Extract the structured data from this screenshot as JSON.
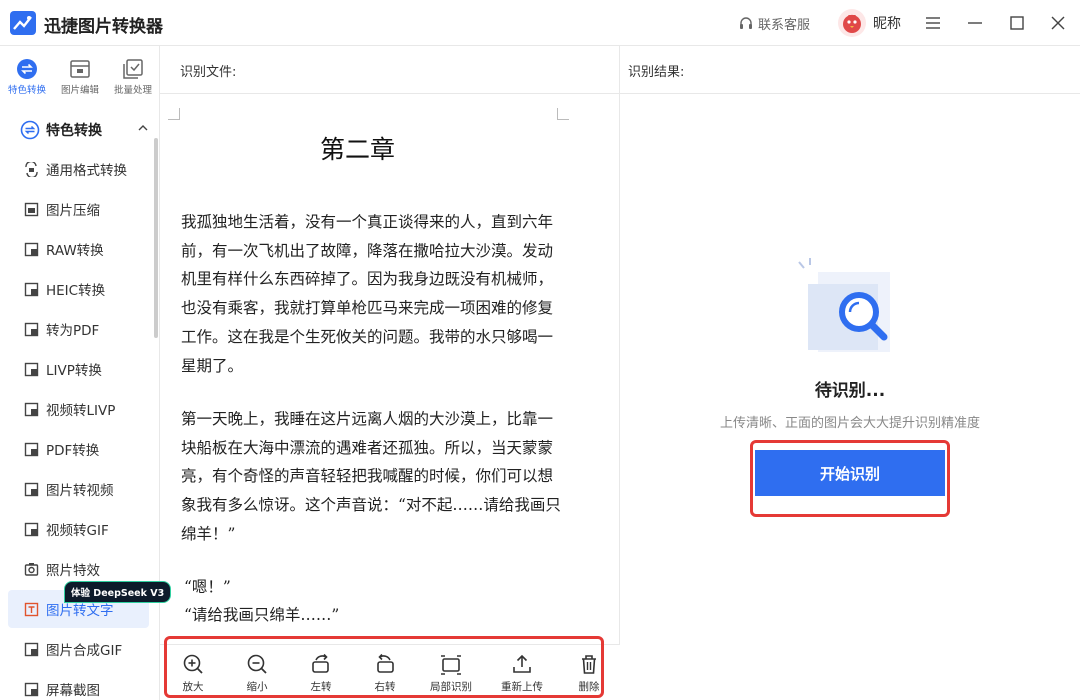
{
  "app": {
    "title": "迅捷图片转换器",
    "support_label": "联系客服",
    "nickname": "昵称",
    "accent_color": "#2f6ef0"
  },
  "top_tabs": [
    {
      "label": "特色转换",
      "icon": "swap-circle-icon",
      "active": true
    },
    {
      "label": "图片编辑",
      "icon": "image-edit-icon",
      "active": false
    },
    {
      "label": "批量处理",
      "icon": "batch-check-icon",
      "active": false
    }
  ],
  "sidebar": {
    "section_label": "特色转换",
    "badge": "体验 DeepSeek V3",
    "items": [
      {
        "label": "通用格式转换",
        "icon": "format-convert-icon"
      },
      {
        "label": "图片压缩",
        "icon": "compress-icon"
      },
      {
        "label": "RAW转换",
        "icon": "raw-icon"
      },
      {
        "label": "HEIC转换",
        "icon": "heic-icon"
      },
      {
        "label": "转为PDF",
        "icon": "pdf-icon"
      },
      {
        "label": "LIVP转换",
        "icon": "livp-icon"
      },
      {
        "label": "视频转LIVP",
        "icon": "video-livp-icon"
      },
      {
        "label": "PDF转换",
        "icon": "pdf-convert-icon"
      },
      {
        "label": "图片转视频",
        "icon": "image-video-icon"
      },
      {
        "label": "视频转GIF",
        "icon": "video-gif-icon"
      },
      {
        "label": "照片特效",
        "icon": "photo-effect-icon"
      },
      {
        "label": "图片转文字",
        "icon": "ocr-icon",
        "active": true
      },
      {
        "label": "图片合成GIF",
        "icon": "gif-compose-icon"
      },
      {
        "label": "屏幕截图",
        "icon": "screenshot-icon"
      }
    ]
  },
  "left_panel": {
    "header": "识别文件:",
    "document": {
      "title": "第二章",
      "paragraphs": [
        "我孤独地生活着，没有一个真正谈得来的人，直到六年前，有一次飞机出了故障，降落在撒哈拉大沙漠。发动机里有样什么东西碎掉了。因为我身边既没有机械师，也没有乘客，我就打算单枪匹马来完成一项困难的修复工作。这在我是个生死攸关的问题。我带的水只够喝一星期了。",
        "第一天晚上，我睡在这片远离人烟的大沙漠上，比靠一块船板在大海中漂流的遇难者还孤独。所以，当天蒙蒙亮，有个奇怪的声音轻轻把我喊醒的时候，你们可以想象我有多么惊讶。这个声音说：“对不起……请给我画只绵羊！”",
        "“嗯！”",
        "“请给我画只绵羊……”"
      ]
    },
    "toolbar": [
      {
        "label": "放大",
        "icon": "zoom-in-icon"
      },
      {
        "label": "缩小",
        "icon": "zoom-out-icon"
      },
      {
        "label": "左转",
        "icon": "rotate-left-icon"
      },
      {
        "label": "右转",
        "icon": "rotate-right-icon"
      },
      {
        "label": "局部识别",
        "icon": "crop-region-icon"
      },
      {
        "label": "重新上传",
        "icon": "upload-icon"
      },
      {
        "label": "删除",
        "icon": "trash-icon"
      }
    ]
  },
  "right_panel": {
    "header": "识别结果:",
    "status": "待识别...",
    "hint": "上传清晰、正面的图片会大大提升识别精准度",
    "start_button": "开始识别"
  }
}
